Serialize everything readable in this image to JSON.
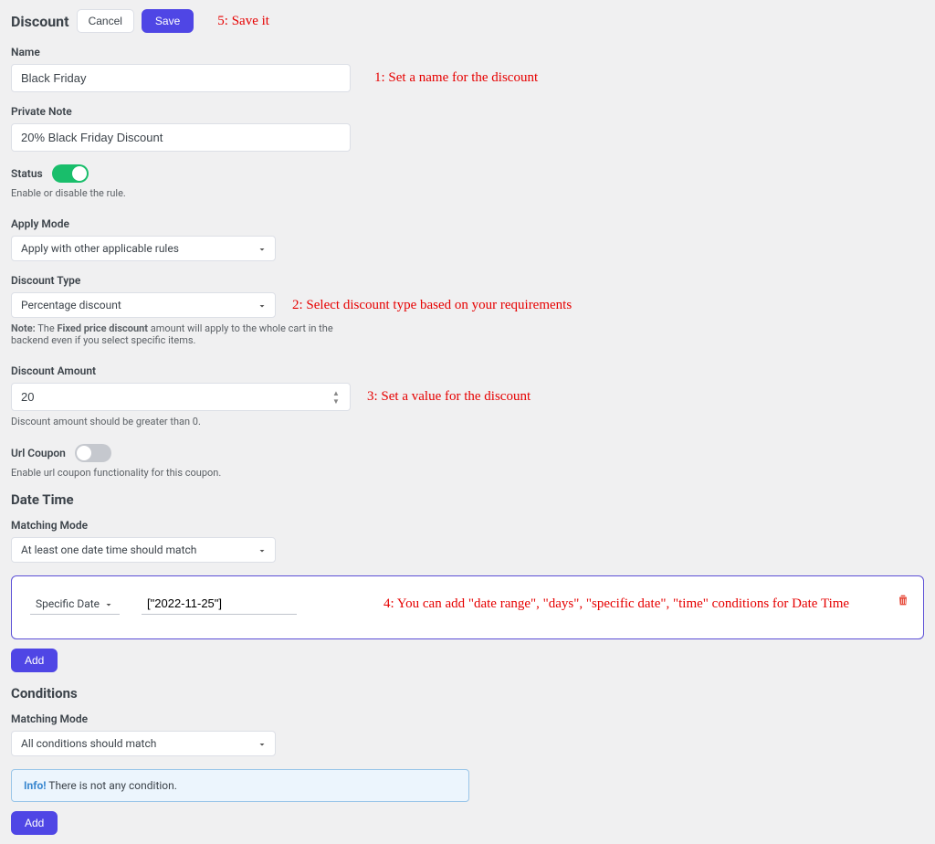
{
  "header": {
    "title": "Discount",
    "cancel": "Cancel",
    "save": "Save",
    "saveAnnotation": "5: Save it"
  },
  "name": {
    "label": "Name",
    "value": "Black Friday",
    "annotation": "1: Set a name for the discount"
  },
  "privateNote": {
    "label": "Private Note",
    "value": "20% Black Friday Discount"
  },
  "status": {
    "label": "Status",
    "on": true,
    "hint": "Enable or disable the rule."
  },
  "applyMode": {
    "label": "Apply Mode",
    "value": "Apply with other applicable rules"
  },
  "discountType": {
    "label": "Discount Type",
    "value": "Percentage discount",
    "annotation": "2: Select discount type based on your requirements",
    "noteBold1": "Note:",
    "notePre": " The ",
    "noteBold2": "Fixed price discount",
    "notePost": " amount will apply to the whole cart in the backend even if you select specific items."
  },
  "discountAmount": {
    "label": "Discount Amount",
    "value": "20",
    "annotation": "3: Set a value for the discount",
    "hint": "Discount amount should be greater than 0."
  },
  "urlCoupon": {
    "label": "Url Coupon",
    "on": false,
    "hint": "Enable url coupon functionality for this coupon."
  },
  "dateTime": {
    "section": "Date Time",
    "matchingLabel": "Matching Mode",
    "matchingValue": "At least one date time should match",
    "row": {
      "type": "Specific Date",
      "value": "[\"2022-11-25\"]",
      "annotation": "4: You can add \"date range\", \"days\", \"specific date\", \"time\" conditions for Date Time"
    },
    "add": "Add"
  },
  "conditions": {
    "section": "Conditions",
    "matchingLabel": "Matching Mode",
    "matchingValue": "All conditions should match",
    "infoBold": "Info!",
    "infoText": " There is not any condition.",
    "add": "Add"
  }
}
